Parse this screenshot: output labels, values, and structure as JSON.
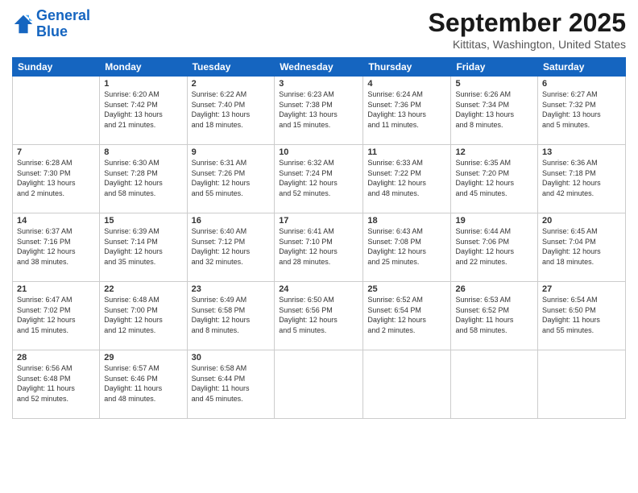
{
  "header": {
    "logo_line1": "General",
    "logo_line2": "Blue",
    "month": "September 2025",
    "location": "Kittitas, Washington, United States"
  },
  "weekdays": [
    "Sunday",
    "Monday",
    "Tuesday",
    "Wednesday",
    "Thursday",
    "Friday",
    "Saturday"
  ],
  "weeks": [
    [
      {
        "num": "",
        "info": ""
      },
      {
        "num": "1",
        "info": "Sunrise: 6:20 AM\nSunset: 7:42 PM\nDaylight: 13 hours\nand 21 minutes."
      },
      {
        "num": "2",
        "info": "Sunrise: 6:22 AM\nSunset: 7:40 PM\nDaylight: 13 hours\nand 18 minutes."
      },
      {
        "num": "3",
        "info": "Sunrise: 6:23 AM\nSunset: 7:38 PM\nDaylight: 13 hours\nand 15 minutes."
      },
      {
        "num": "4",
        "info": "Sunrise: 6:24 AM\nSunset: 7:36 PM\nDaylight: 13 hours\nand 11 minutes."
      },
      {
        "num": "5",
        "info": "Sunrise: 6:26 AM\nSunset: 7:34 PM\nDaylight: 13 hours\nand 8 minutes."
      },
      {
        "num": "6",
        "info": "Sunrise: 6:27 AM\nSunset: 7:32 PM\nDaylight: 13 hours\nand 5 minutes."
      }
    ],
    [
      {
        "num": "7",
        "info": "Sunrise: 6:28 AM\nSunset: 7:30 PM\nDaylight: 13 hours\nand 2 minutes."
      },
      {
        "num": "8",
        "info": "Sunrise: 6:30 AM\nSunset: 7:28 PM\nDaylight: 12 hours\nand 58 minutes."
      },
      {
        "num": "9",
        "info": "Sunrise: 6:31 AM\nSunset: 7:26 PM\nDaylight: 12 hours\nand 55 minutes."
      },
      {
        "num": "10",
        "info": "Sunrise: 6:32 AM\nSunset: 7:24 PM\nDaylight: 12 hours\nand 52 minutes."
      },
      {
        "num": "11",
        "info": "Sunrise: 6:33 AM\nSunset: 7:22 PM\nDaylight: 12 hours\nand 48 minutes."
      },
      {
        "num": "12",
        "info": "Sunrise: 6:35 AM\nSunset: 7:20 PM\nDaylight: 12 hours\nand 45 minutes."
      },
      {
        "num": "13",
        "info": "Sunrise: 6:36 AM\nSunset: 7:18 PM\nDaylight: 12 hours\nand 42 minutes."
      }
    ],
    [
      {
        "num": "14",
        "info": "Sunrise: 6:37 AM\nSunset: 7:16 PM\nDaylight: 12 hours\nand 38 minutes."
      },
      {
        "num": "15",
        "info": "Sunrise: 6:39 AM\nSunset: 7:14 PM\nDaylight: 12 hours\nand 35 minutes."
      },
      {
        "num": "16",
        "info": "Sunrise: 6:40 AM\nSunset: 7:12 PM\nDaylight: 12 hours\nand 32 minutes."
      },
      {
        "num": "17",
        "info": "Sunrise: 6:41 AM\nSunset: 7:10 PM\nDaylight: 12 hours\nand 28 minutes."
      },
      {
        "num": "18",
        "info": "Sunrise: 6:43 AM\nSunset: 7:08 PM\nDaylight: 12 hours\nand 25 minutes."
      },
      {
        "num": "19",
        "info": "Sunrise: 6:44 AM\nSunset: 7:06 PM\nDaylight: 12 hours\nand 22 minutes."
      },
      {
        "num": "20",
        "info": "Sunrise: 6:45 AM\nSunset: 7:04 PM\nDaylight: 12 hours\nand 18 minutes."
      }
    ],
    [
      {
        "num": "21",
        "info": "Sunrise: 6:47 AM\nSunset: 7:02 PM\nDaylight: 12 hours\nand 15 minutes."
      },
      {
        "num": "22",
        "info": "Sunrise: 6:48 AM\nSunset: 7:00 PM\nDaylight: 12 hours\nand 12 minutes."
      },
      {
        "num": "23",
        "info": "Sunrise: 6:49 AM\nSunset: 6:58 PM\nDaylight: 12 hours\nand 8 minutes."
      },
      {
        "num": "24",
        "info": "Sunrise: 6:50 AM\nSunset: 6:56 PM\nDaylight: 12 hours\nand 5 minutes."
      },
      {
        "num": "25",
        "info": "Sunrise: 6:52 AM\nSunset: 6:54 PM\nDaylight: 12 hours\nand 2 minutes."
      },
      {
        "num": "26",
        "info": "Sunrise: 6:53 AM\nSunset: 6:52 PM\nDaylight: 11 hours\nand 58 minutes."
      },
      {
        "num": "27",
        "info": "Sunrise: 6:54 AM\nSunset: 6:50 PM\nDaylight: 11 hours\nand 55 minutes."
      }
    ],
    [
      {
        "num": "28",
        "info": "Sunrise: 6:56 AM\nSunset: 6:48 PM\nDaylight: 11 hours\nand 52 minutes."
      },
      {
        "num": "29",
        "info": "Sunrise: 6:57 AM\nSunset: 6:46 PM\nDaylight: 11 hours\nand 48 minutes."
      },
      {
        "num": "30",
        "info": "Sunrise: 6:58 AM\nSunset: 6:44 PM\nDaylight: 11 hours\nand 45 minutes."
      },
      {
        "num": "",
        "info": ""
      },
      {
        "num": "",
        "info": ""
      },
      {
        "num": "",
        "info": ""
      },
      {
        "num": "",
        "info": ""
      }
    ]
  ]
}
